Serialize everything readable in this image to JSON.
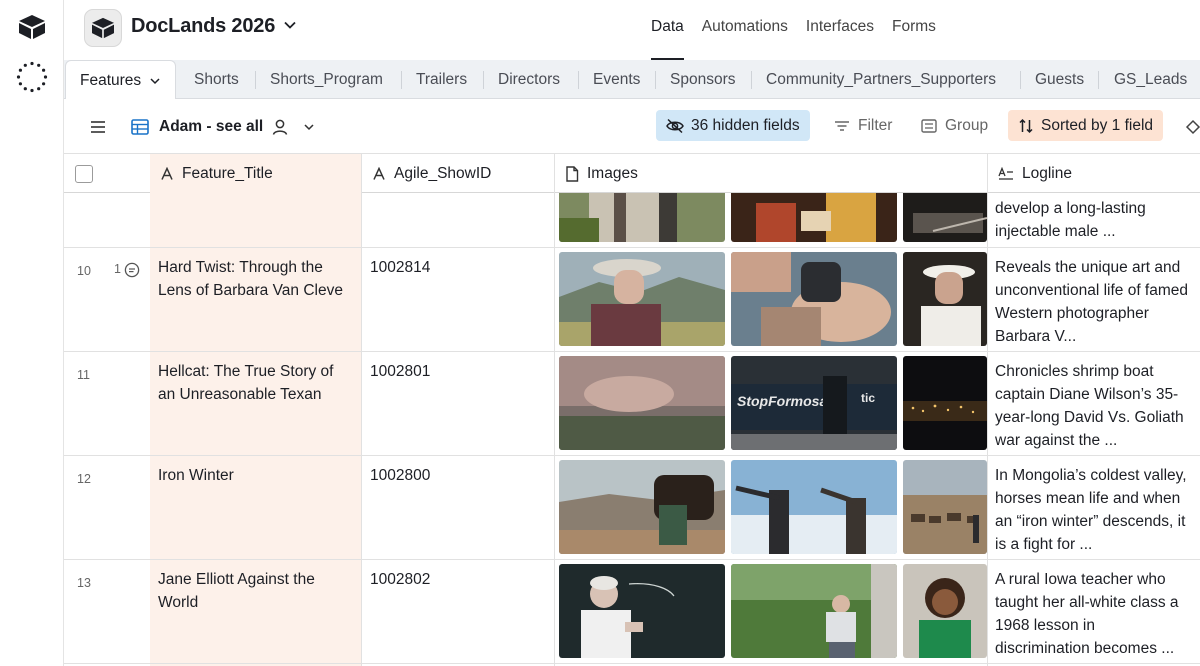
{
  "base": {
    "name": "DocLands 2026"
  },
  "topnav": [
    "Data",
    "Automations",
    "Interfaces",
    "Forms"
  ],
  "tabs": [
    "Features",
    "Shorts",
    "Shorts_Program",
    "Trailers",
    "Directors",
    "Events",
    "Sponsors",
    "Community_Partners_Supporters",
    "Guests",
    "GS_Leads"
  ],
  "view": {
    "name": "Adam - see all",
    "hidden_fields": "36 hidden fields",
    "filter": "Filter",
    "group": "Group",
    "sorted": "Sorted by 1 field"
  },
  "columns": {
    "title": "Feature_Title",
    "showid": "Agile_ShowID",
    "images": "Images",
    "logline": "Logline"
  },
  "rows": [
    {
      "num": "",
      "comments": "",
      "title": "",
      "showid": "",
      "logline": "develop a long-lasting injectable male ..."
    },
    {
      "num": "10",
      "comments": "1",
      "title": "Hard Twist: Through the Lens of Barbara Van Cleve",
      "showid": "1002814",
      "logline": "Reveals the unique art and unconventional life of famed Western photographer Barbara V..."
    },
    {
      "num": "11",
      "comments": "",
      "title": "Hellcat: The True Story of an Unreasonable Texan",
      "showid": "1002801",
      "logline": "Chronicles shrimp boat captain Diane Wilson’s 35-year-long David Vs. Goliath war against the ..."
    },
    {
      "num": "12",
      "comments": "",
      "title": "Iron Winter",
      "showid": "1002800",
      "logline": "In Mongolia’s coldest valley, horses mean life and when an “iron winter” descends, it is a fight for ..."
    },
    {
      "num": "13",
      "comments": "",
      "title": "Jane Elliott Against the World",
      "showid": "1002802",
      "logline": "A rural Iowa teacher who taught her all-white class a 1968 lesson in discrimination becomes ..."
    }
  ],
  "thumb_text": {
    "sign_line1": "StopFormosa",
    "sign_line2": "tic"
  }
}
